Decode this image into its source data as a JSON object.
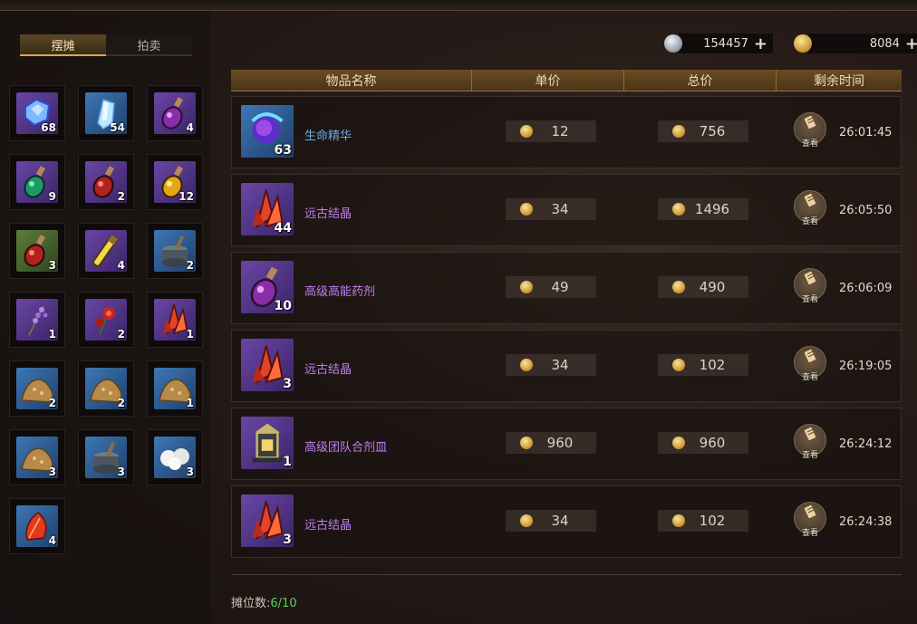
{
  "tabs": [
    {
      "label": "摆摊",
      "active": true
    },
    {
      "label": "拍卖",
      "active": false
    }
  ],
  "currency": {
    "silver": {
      "value": "154457",
      "icon": "silver-coin-icon"
    },
    "gold": {
      "value": "8084",
      "icon": "gold-coin-icon"
    },
    "plus_symbol": "+"
  },
  "inventory": [
    {
      "icon": "blue-gem-icon",
      "qty": "68",
      "rarity": "purple"
    },
    {
      "icon": "ice-crystal-icon",
      "qty": "54",
      "rarity": "blue"
    },
    {
      "icon": "purple-potion-icon",
      "qty": "4",
      "rarity": "purple"
    },
    {
      "icon": "green-potion-icon",
      "qty": "9",
      "rarity": "purple"
    },
    {
      "icon": "red-potion-icon",
      "qty": "2",
      "rarity": "purple"
    },
    {
      "icon": "yellow-potion-icon",
      "qty": "12",
      "rarity": "purple"
    },
    {
      "icon": "red-potion-icon",
      "qty": "3",
      "rarity": "green"
    },
    {
      "icon": "yellow-vial-icon",
      "qty": "4",
      "rarity": "purple"
    },
    {
      "icon": "mortar-icon",
      "qty": "2",
      "rarity": "blue"
    },
    {
      "icon": "lavender-herb-icon",
      "qty": "1",
      "rarity": "purple"
    },
    {
      "icon": "red-flower-icon",
      "qty": "2",
      "rarity": "purple"
    },
    {
      "icon": "red-crystal-icon",
      "qty": "1",
      "rarity": "purple"
    },
    {
      "icon": "ore-pile-icon",
      "qty": "2",
      "rarity": "blue"
    },
    {
      "icon": "ore-pile-icon",
      "qty": "2",
      "rarity": "blue"
    },
    {
      "icon": "ore-pile-icon",
      "qty": "1",
      "rarity": "blue"
    },
    {
      "icon": "ore-pile-icon",
      "qty": "3",
      "rarity": "blue"
    },
    {
      "icon": "mortar-icon",
      "qty": "3",
      "rarity": "blue"
    },
    {
      "icon": "cotton-icon",
      "qty": "3",
      "rarity": "blue"
    },
    {
      "icon": "red-leaf-icon",
      "qty": "4",
      "rarity": "blue"
    }
  ],
  "table": {
    "headers": [
      "物品名称",
      "单价",
      "总价",
      "剩余时间"
    ],
    "view_label": "查看",
    "rows": [
      {
        "icon": "essence-orb-icon",
        "qty": "63",
        "name": "生命精华",
        "name_color": "#6aa7e8",
        "rarity": "blue",
        "unit": "12",
        "total": "756",
        "time": "26:01:45"
      },
      {
        "icon": "red-crystal-icon",
        "qty": "44",
        "name": "远古结晶",
        "name_color": "#c07ef0",
        "rarity": "purple",
        "unit": "34",
        "total": "1496",
        "time": "26:05:50"
      },
      {
        "icon": "purple-potion-icon",
        "qty": "10",
        "name": "高级高能药剂",
        "name_color": "#c07ef0",
        "rarity": "purple",
        "unit": "49",
        "total": "490",
        "time": "26:06:09"
      },
      {
        "icon": "red-crystal-icon",
        "qty": "3",
        "name": "远古结晶",
        "name_color": "#c07ef0",
        "rarity": "purple",
        "unit": "34",
        "total": "102",
        "time": "26:19:05"
      },
      {
        "icon": "lantern-stove-icon",
        "qty": "1",
        "name": "高级团队合剂皿",
        "name_color": "#c07ef0",
        "rarity": "purple",
        "unit": "960",
        "total": "960",
        "time": "26:24:12"
      },
      {
        "icon": "red-crystal-icon",
        "qty": "3",
        "name": "远古结晶",
        "name_color": "#c07ef0",
        "rarity": "purple",
        "unit": "34",
        "total": "102",
        "time": "26:24:38"
      }
    ]
  },
  "footer": {
    "label": "摊位数:",
    "value": "6/10"
  }
}
